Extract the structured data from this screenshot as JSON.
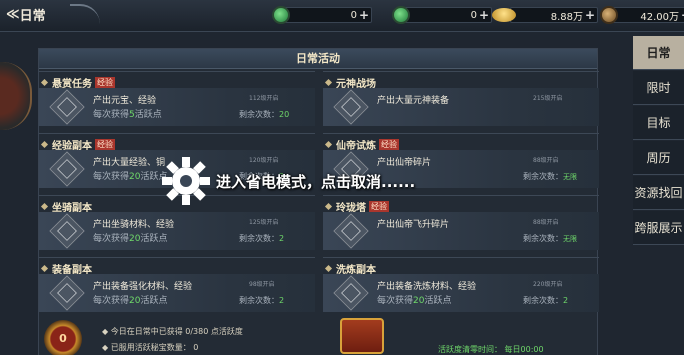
{
  "header": {
    "back_arrow": "≪",
    "title": "日常"
  },
  "resources": [
    {
      "icon": "jade-icon",
      "value": "0",
      "plus": "+"
    },
    {
      "icon": "jade-icon",
      "value": "0",
      "plus": "+"
    },
    {
      "icon": "gold-ingot-icon",
      "value": "8.88万",
      "plus": "+"
    },
    {
      "icon": "coin-icon",
      "value": "42.00万",
      "plus": "+"
    }
  ],
  "panel_title": "日常活动",
  "activities": [
    {
      "name": "悬赏任务",
      "tag": "经验",
      "line1": "产出元宝、经验",
      "line2_prefix": "每次获得",
      "line2_highlight": "5",
      "line2_suffix": "活跃点",
      "level": "112级开启",
      "remaining_label": "剩余次数：",
      "remaining_value": "20"
    },
    {
      "name": "元神战场",
      "tag": "",
      "line1": "产出大量元神装备",
      "line2_prefix": "",
      "line2_highlight": "",
      "line2_suffix": "",
      "level": "215级开启",
      "remaining_label": "",
      "remaining_value": ""
    },
    {
      "name": "经验副本",
      "tag": "经验",
      "line1": "产出大量经验、铜",
      "line2_prefix": "每次获得",
      "line2_highlight": "20",
      "line2_suffix": "活跃点",
      "level": "120级开启",
      "remaining_label": "剩余次数：",
      "remaining_value": "2"
    },
    {
      "name": "仙帝试炼",
      "tag": "经验",
      "line1": "产出仙帝碎片",
      "line2_prefix": "",
      "line2_highlight": "",
      "line2_suffix": "",
      "level": "88级开启",
      "remaining_label": "剩余次数：",
      "remaining_value": "无限"
    },
    {
      "name": "坐骑副本",
      "tag": "",
      "line1": "产出坐骑材料、经验",
      "line2_prefix": "每次获得",
      "line2_highlight": "20",
      "line2_suffix": "活跃点",
      "level": "125级开启",
      "remaining_label": "剩余次数：",
      "remaining_value": "2"
    },
    {
      "name": "玲珑塔",
      "tag": "经验",
      "line1": "产出仙帝飞升碎片",
      "line2_prefix": "",
      "line2_highlight": "",
      "line2_suffix": "",
      "level": "88级开启",
      "remaining_label": "剩余次数：",
      "remaining_value": "无限"
    },
    {
      "name": "装备副本",
      "tag": "",
      "line1": "产出装备强化材料、经验",
      "line2_prefix": "每次获得",
      "line2_highlight": "20",
      "line2_suffix": "活跃点",
      "level": "98级开启",
      "remaining_label": "剩余次数：",
      "remaining_value": "2"
    },
    {
      "name": "洗炼副本",
      "tag": "",
      "line1": "产出装备洗炼材料、经验",
      "line2_prefix": "每次获得",
      "line2_highlight": "20",
      "line2_suffix": "活跃点",
      "level": "220级开启",
      "remaining_label": "剩余次数：",
      "remaining_value": "2"
    }
  ],
  "bottom": {
    "medal_value": "0",
    "info1": "◆ 今日在日常中已获得 0/380 点活跃度",
    "info2": "◆ 已服用活跃秘宝数量：  0",
    "reset": "活跃度清零时间： 每日00:00"
  },
  "tabs": [
    "日常",
    "限时",
    "目标",
    "周历",
    "资源找回",
    "跨服展示"
  ],
  "overlay_text": "进入省电模式，点击取消......"
}
